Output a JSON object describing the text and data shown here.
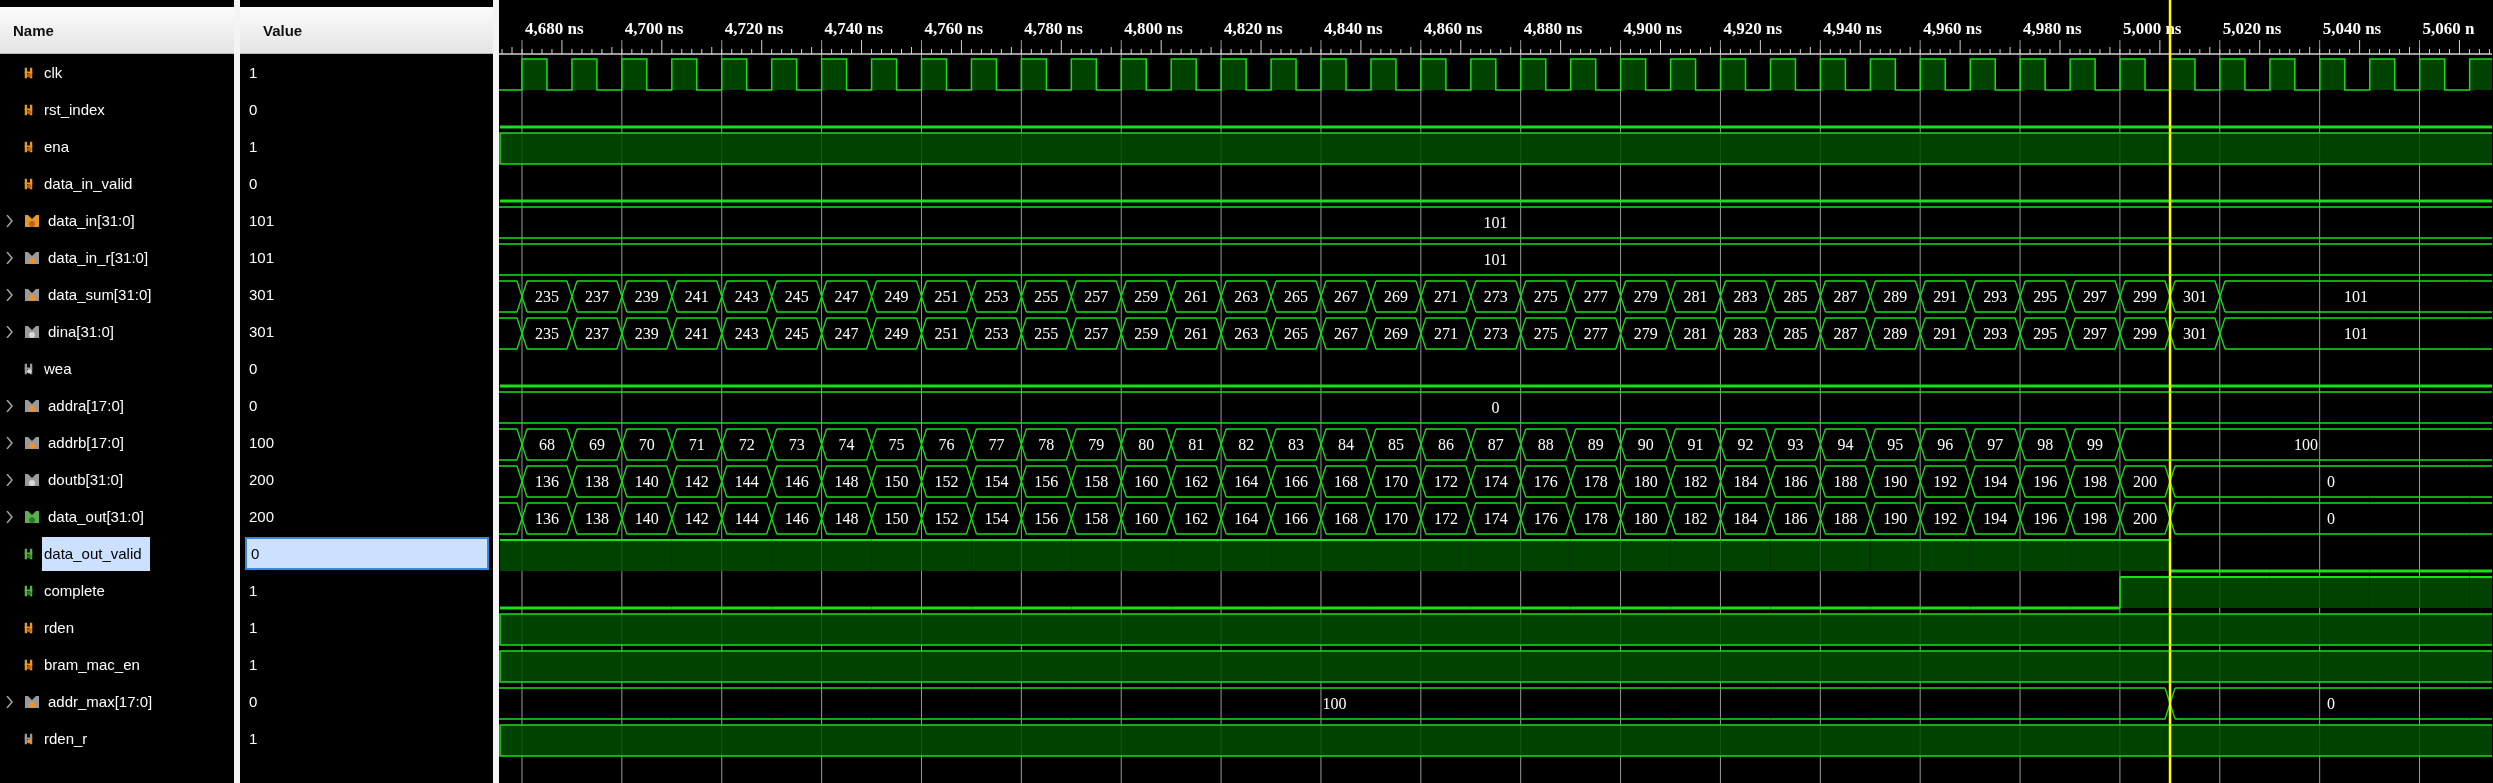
{
  "columns": {
    "name": "Name",
    "value": "Value"
  },
  "ruler": {
    "labels": [
      "4,680 ns",
      "4,700 ns",
      "4,720 ns",
      "4,740 ns",
      "4,760 ns",
      "4,780 ns",
      "4,800 ns",
      "4,820 ns",
      "4,840 ns",
      "4,860 ns",
      "4,880 ns",
      "4,900 ns",
      "4,920 ns",
      "4,940 ns",
      "4,960 ns",
      "4,980 ns",
      "5,000 ns",
      "5,020 ns",
      "5,040 ns",
      "5,060 n"
    ]
  },
  "signals": [
    {
      "name": "clk",
      "value": "1",
      "kind": "input",
      "selected": false,
      "wave": {
        "kind": "clock"
      }
    },
    {
      "name": "rst_index",
      "value": "0",
      "kind": "input",
      "selected": false,
      "wave": {
        "kind": "level",
        "high": false
      }
    },
    {
      "name": "ena",
      "value": "1",
      "kind": "input",
      "selected": false,
      "wave": {
        "kind": "level",
        "high": true
      }
    },
    {
      "name": "data_in_valid",
      "value": "0",
      "kind": "input",
      "selected": false,
      "wave": {
        "kind": "level",
        "high": false
      }
    },
    {
      "name": "data_in[31:0]",
      "value": "101",
      "kind": "input",
      "expanded": false,
      "selected": false,
      "wave": {
        "kind": "bus",
        "values": [
          "101"
        ]
      }
    },
    {
      "name": "data_in_r[31:0]",
      "value": "101",
      "kind": "register",
      "expanded": false,
      "selected": false,
      "wave": {
        "kind": "bus",
        "values": [
          "101"
        ]
      }
    },
    {
      "name": "data_sum[31:0]",
      "value": "301",
      "kind": "register",
      "expanded": false,
      "selected": false,
      "wave": {
        "kind": "bus",
        "values": [
          "235",
          "237",
          "239",
          "241",
          "243",
          "245",
          "247",
          "249",
          "251",
          "253",
          "255",
          "257",
          "259",
          "261",
          "263",
          "265",
          "267",
          "269",
          "271",
          "273",
          "275",
          "277",
          "279",
          "281",
          "283",
          "285",
          "287",
          "289",
          "291",
          "293",
          "295",
          "297",
          "299",
          "301",
          "101"
        ],
        "edges": [
          false,
          true,
          true,
          true,
          true,
          true,
          true,
          true,
          true,
          true,
          true,
          true,
          true,
          true,
          true,
          true,
          true,
          true,
          true,
          true,
          true,
          true,
          true,
          true,
          true,
          true,
          true,
          true,
          true,
          true,
          true,
          true,
          true,
          true,
          true,
          true,
          false,
          false,
          false,
          false,
          false
        ]
      }
    },
    {
      "name": "dina[31:0]",
      "value": "301",
      "kind": "wire",
      "expanded": false,
      "selected": false,
      "wave": {
        "kind": "bus",
        "values": [
          "235",
          "237",
          "239",
          "241",
          "243",
          "245",
          "247",
          "249",
          "251",
          "253",
          "255",
          "257",
          "259",
          "261",
          "263",
          "265",
          "267",
          "269",
          "271",
          "273",
          "275",
          "277",
          "279",
          "281",
          "283",
          "285",
          "287",
          "289",
          "291",
          "293",
          "295",
          "297",
          "299",
          "301",
          "101"
        ],
        "edges": [
          false,
          true,
          true,
          true,
          true,
          true,
          true,
          true,
          true,
          true,
          true,
          true,
          true,
          true,
          true,
          true,
          true,
          true,
          true,
          true,
          true,
          true,
          true,
          true,
          true,
          true,
          true,
          true,
          true,
          true,
          true,
          true,
          true,
          true,
          true,
          true,
          false,
          false,
          false,
          false,
          false
        ]
      }
    },
    {
      "name": "wea",
      "value": "0",
      "kind": "wire",
      "selected": false,
      "wave": {
        "kind": "level",
        "high": false
      }
    },
    {
      "name": "addra[17:0]",
      "value": "0",
      "kind": "register",
      "expanded": false,
      "selected": false,
      "wave": {
        "kind": "bus",
        "values": [
          "0"
        ]
      }
    },
    {
      "name": "addrb[17:0]",
      "value": "100",
      "kind": "register",
      "expanded": false,
      "selected": false,
      "wave": {
        "kind": "bus",
        "values": [
          "68",
          "69",
          "70",
          "71",
          "72",
          "73",
          "74",
          "75",
          "76",
          "77",
          "78",
          "79",
          "80",
          "81",
          "82",
          "83",
          "84",
          "85",
          "86",
          "87",
          "88",
          "89",
          "90",
          "91",
          "92",
          "93",
          "94",
          "95",
          "96",
          "97",
          "98",
          "99",
          "100"
        ],
        "edges": [
          false,
          true,
          true,
          true,
          true,
          true,
          true,
          true,
          true,
          true,
          true,
          true,
          true,
          true,
          true,
          true,
          true,
          true,
          true,
          true,
          true,
          true,
          true,
          true,
          true,
          true,
          true,
          true,
          true,
          true,
          true,
          true,
          true,
          true,
          false,
          false,
          false,
          false,
          false,
          false,
          false
        ]
      }
    },
    {
      "name": "doutb[31:0]",
      "value": "200",
      "kind": "wire",
      "expanded": false,
      "selected": false,
      "wave": {
        "kind": "bus",
        "values": [
          "136",
          "138",
          "140",
          "142",
          "144",
          "146",
          "148",
          "150",
          "152",
          "154",
          "156",
          "158",
          "160",
          "162",
          "164",
          "166",
          "168",
          "170",
          "172",
          "174",
          "176",
          "178",
          "180",
          "182",
          "184",
          "186",
          "188",
          "190",
          "192",
          "194",
          "196",
          "198",
          "200",
          "0"
        ],
        "edges": [
          false,
          true,
          true,
          true,
          true,
          true,
          true,
          true,
          true,
          true,
          true,
          true,
          true,
          true,
          true,
          true,
          true,
          true,
          true,
          true,
          true,
          true,
          true,
          true,
          true,
          true,
          true,
          true,
          true,
          true,
          true,
          true,
          true,
          true,
          true,
          false,
          false,
          false,
          false,
          false,
          false
        ]
      }
    },
    {
      "name": "data_out[31:0]",
      "value": "200",
      "kind": "output",
      "expanded": false,
      "selected": false,
      "wave": {
        "kind": "bus",
        "values": [
          "136",
          "138",
          "140",
          "142",
          "144",
          "146",
          "148",
          "150",
          "152",
          "154",
          "156",
          "158",
          "160",
          "162",
          "164",
          "166",
          "168",
          "170",
          "172",
          "174",
          "176",
          "178",
          "180",
          "182",
          "184",
          "186",
          "188",
          "190",
          "192",
          "194",
          "196",
          "198",
          "200",
          "0"
        ],
        "edges": [
          false,
          true,
          true,
          true,
          true,
          true,
          true,
          true,
          true,
          true,
          true,
          true,
          true,
          true,
          true,
          true,
          true,
          true,
          true,
          true,
          true,
          true,
          true,
          true,
          true,
          true,
          true,
          true,
          true,
          true,
          true,
          true,
          true,
          true,
          true,
          false,
          false,
          false,
          false,
          false,
          false
        ]
      }
    },
    {
      "name": "data_out_valid",
      "value": "0",
      "kind": "output",
      "selected": true,
      "wave": {
        "kind": "steps",
        "levels": [
          true,
          true,
          true,
          true,
          true,
          true,
          true,
          true,
          true,
          true,
          true,
          true,
          true,
          true,
          true,
          true,
          true,
          true,
          true,
          true,
          true,
          true,
          true,
          true,
          true,
          true,
          true,
          true,
          true,
          true,
          true,
          true,
          true,
          true,
          false,
          false,
          false,
          false,
          false,
          false,
          false
        ]
      }
    },
    {
      "name": "complete",
      "value": "1",
      "kind": "output",
      "selected": false,
      "wave": {
        "kind": "steps",
        "levels": [
          false,
          false,
          false,
          false,
          false,
          false,
          false,
          false,
          false,
          false,
          false,
          false,
          false,
          false,
          false,
          false,
          false,
          false,
          false,
          false,
          false,
          false,
          false,
          false,
          false,
          false,
          false,
          false,
          false,
          false,
          false,
          false,
          false,
          true,
          true,
          true,
          true,
          true,
          true,
          true,
          true
        ]
      }
    },
    {
      "name": "rden",
      "value": "1",
      "kind": "input",
      "selected": false,
      "wave": {
        "kind": "level",
        "high": true
      }
    },
    {
      "name": "bram_mac_en",
      "value": "1",
      "kind": "input",
      "selected": false,
      "wave": {
        "kind": "level",
        "high": true
      }
    },
    {
      "name": "addr_max[17:0]",
      "value": "0",
      "kind": "register",
      "expanded": false,
      "selected": false,
      "wave": {
        "kind": "bus",
        "values": [
          "100",
          "0"
        ],
        "edges": [
          false,
          false,
          false,
          false,
          false,
          false,
          false,
          false,
          false,
          false,
          false,
          false,
          false,
          false,
          false,
          false,
          false,
          false,
          false,
          false,
          false,
          false,
          false,
          false,
          false,
          false,
          false,
          false,
          false,
          false,
          false,
          false,
          false,
          false,
          true,
          false,
          false,
          false,
          false,
          false,
          false
        ]
      }
    },
    {
      "name": "rden_r",
      "value": "1",
      "kind": "register",
      "selected": false,
      "wave": {
        "kind": "level",
        "high": true
      }
    }
  ]
}
